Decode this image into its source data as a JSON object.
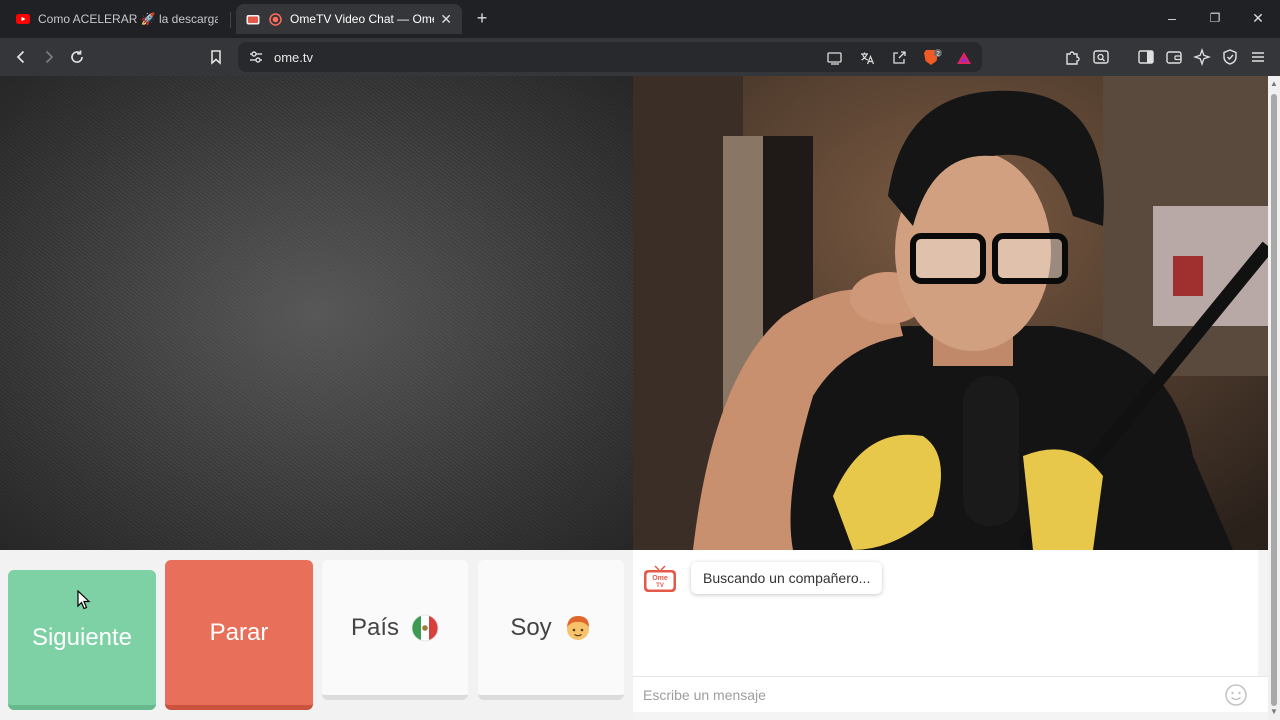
{
  "tabs": [
    {
      "title": "Como ACELERAR 🚀 la descarga de",
      "active": false
    },
    {
      "title": "OmeTV Video Chat — Omegle",
      "active": true
    }
  ],
  "window": {
    "new_tab": "+",
    "minimize": "–",
    "restore": "❐",
    "close": "✕"
  },
  "address": {
    "url": "ome.tv"
  },
  "extensions": {
    "brave_badge": "2"
  },
  "buttons": {
    "next": "Siguiente",
    "stop": "Parar",
    "country": "País",
    "gender": "Soy"
  },
  "chat": {
    "status": "Buscando un compañero...",
    "logo_text_1": "Ome",
    "logo_text_2": "TV",
    "input_placeholder": "Escribe un mensaje"
  },
  "colors": {
    "next": "#7ed1a4",
    "stop": "#e8705a",
    "neutral": "#fafafa",
    "browser_dark": "#35363a"
  },
  "icons": {
    "country_flag": "mexico-flag-icon",
    "gender": "boy-face-icon"
  }
}
